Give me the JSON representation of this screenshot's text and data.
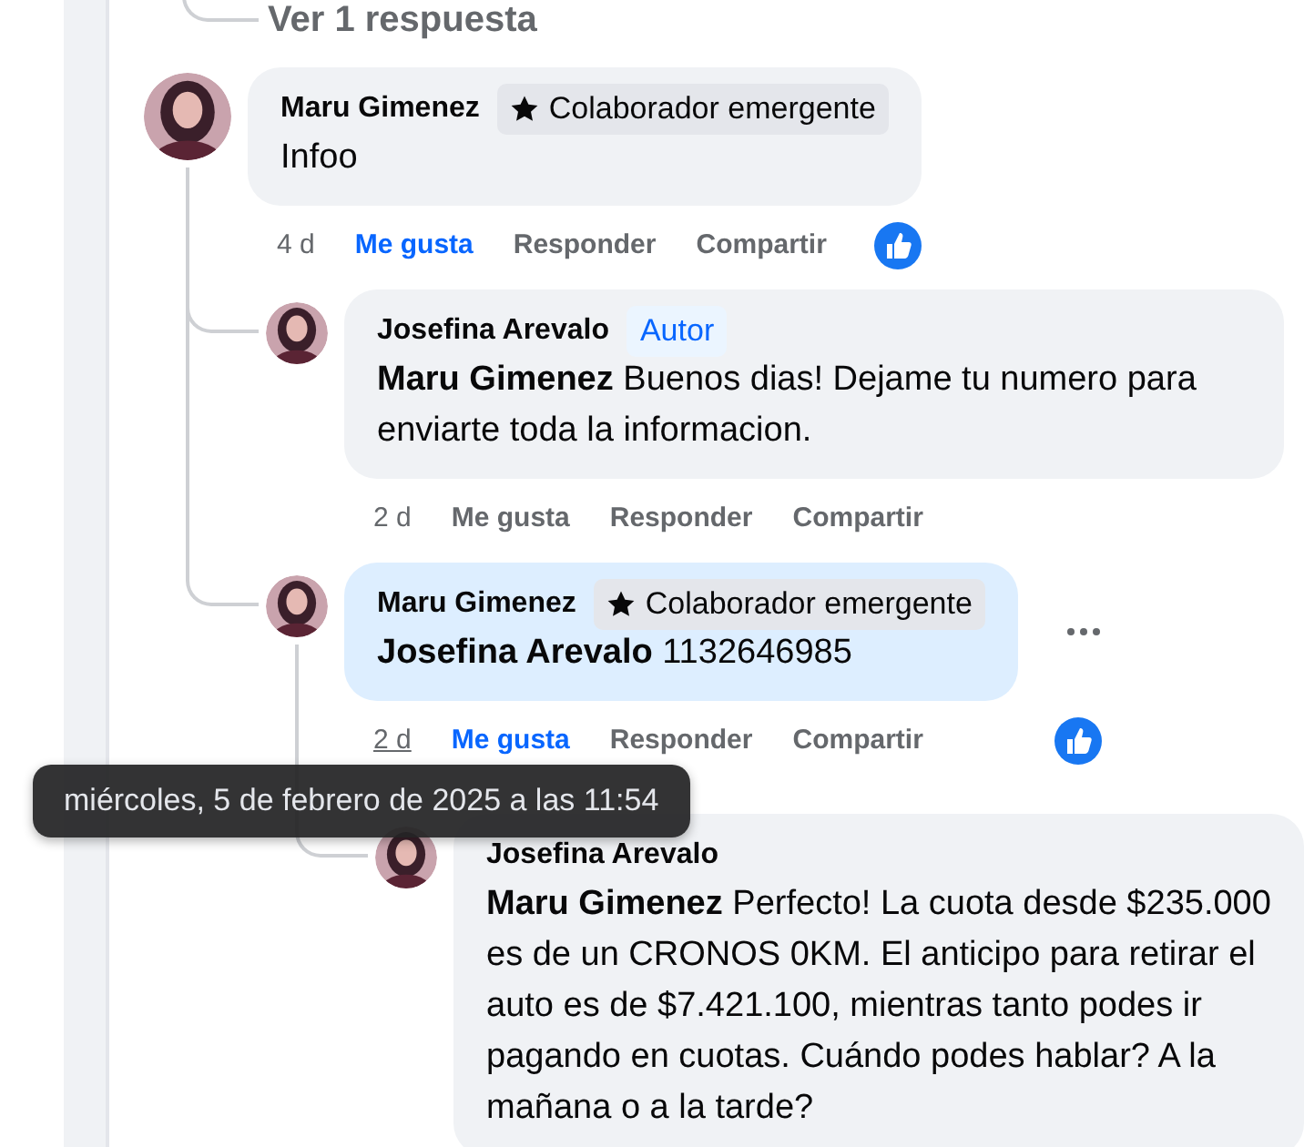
{
  "view_replies": {
    "label": "Ver 1 respuesta"
  },
  "comments": [
    {
      "author": "Maru Gimenez",
      "badge": {
        "kind": "contributor",
        "label": "Colaborador emergente"
      },
      "text": "Infoo",
      "highlighted": false,
      "time": "4 d",
      "time_hovered": false,
      "like_label": "Me gusta",
      "liked": true,
      "reply_label": "Responder",
      "share_label": "Compartir",
      "like_reaction": true,
      "more_menu": false,
      "replies": [
        {
          "author": "Josefina Arevalo",
          "badge": {
            "kind": "author",
            "label": "Autor"
          },
          "text": "**Maru Gimenez** Buenos dias! Dejame tu numero para enviarte toda la informacion.",
          "highlighted": false,
          "time": "2 d",
          "time_hovered": false,
          "like_label": "Me gusta",
          "liked": false,
          "reply_label": "Responder",
          "share_label": "Compartir",
          "like_reaction": false,
          "more_menu": false
        },
        {
          "author": "Maru Gimenez",
          "badge": {
            "kind": "contributor",
            "label": "Colaborador emergente"
          },
          "text": "**Josefina Arevalo** 1132646985",
          "highlighted": true,
          "time": "2 d",
          "time_hovered": true,
          "like_label": "Me gusta",
          "liked": true,
          "reply_label": "Responder",
          "share_label": "Compartir",
          "like_reaction": true,
          "more_menu": true,
          "replies": [
            {
              "author": "Josefina Arevalo",
              "text": "**Maru Gimenez** Perfecto! La cuota desde $235.000 es de un CRONOS 0KM. El anticipo para retirar el auto es de $7.421.100, mientras tanto podes ir pagando en cuotas. Cuándo podes hablar? A la mañana o a la tarde?",
              "highlighted": false,
              "more_menu": false
            }
          ]
        }
      ]
    }
  ],
  "tooltip": {
    "text": "miércoles, 5 de febrero de 2025 a las 11:54"
  }
}
